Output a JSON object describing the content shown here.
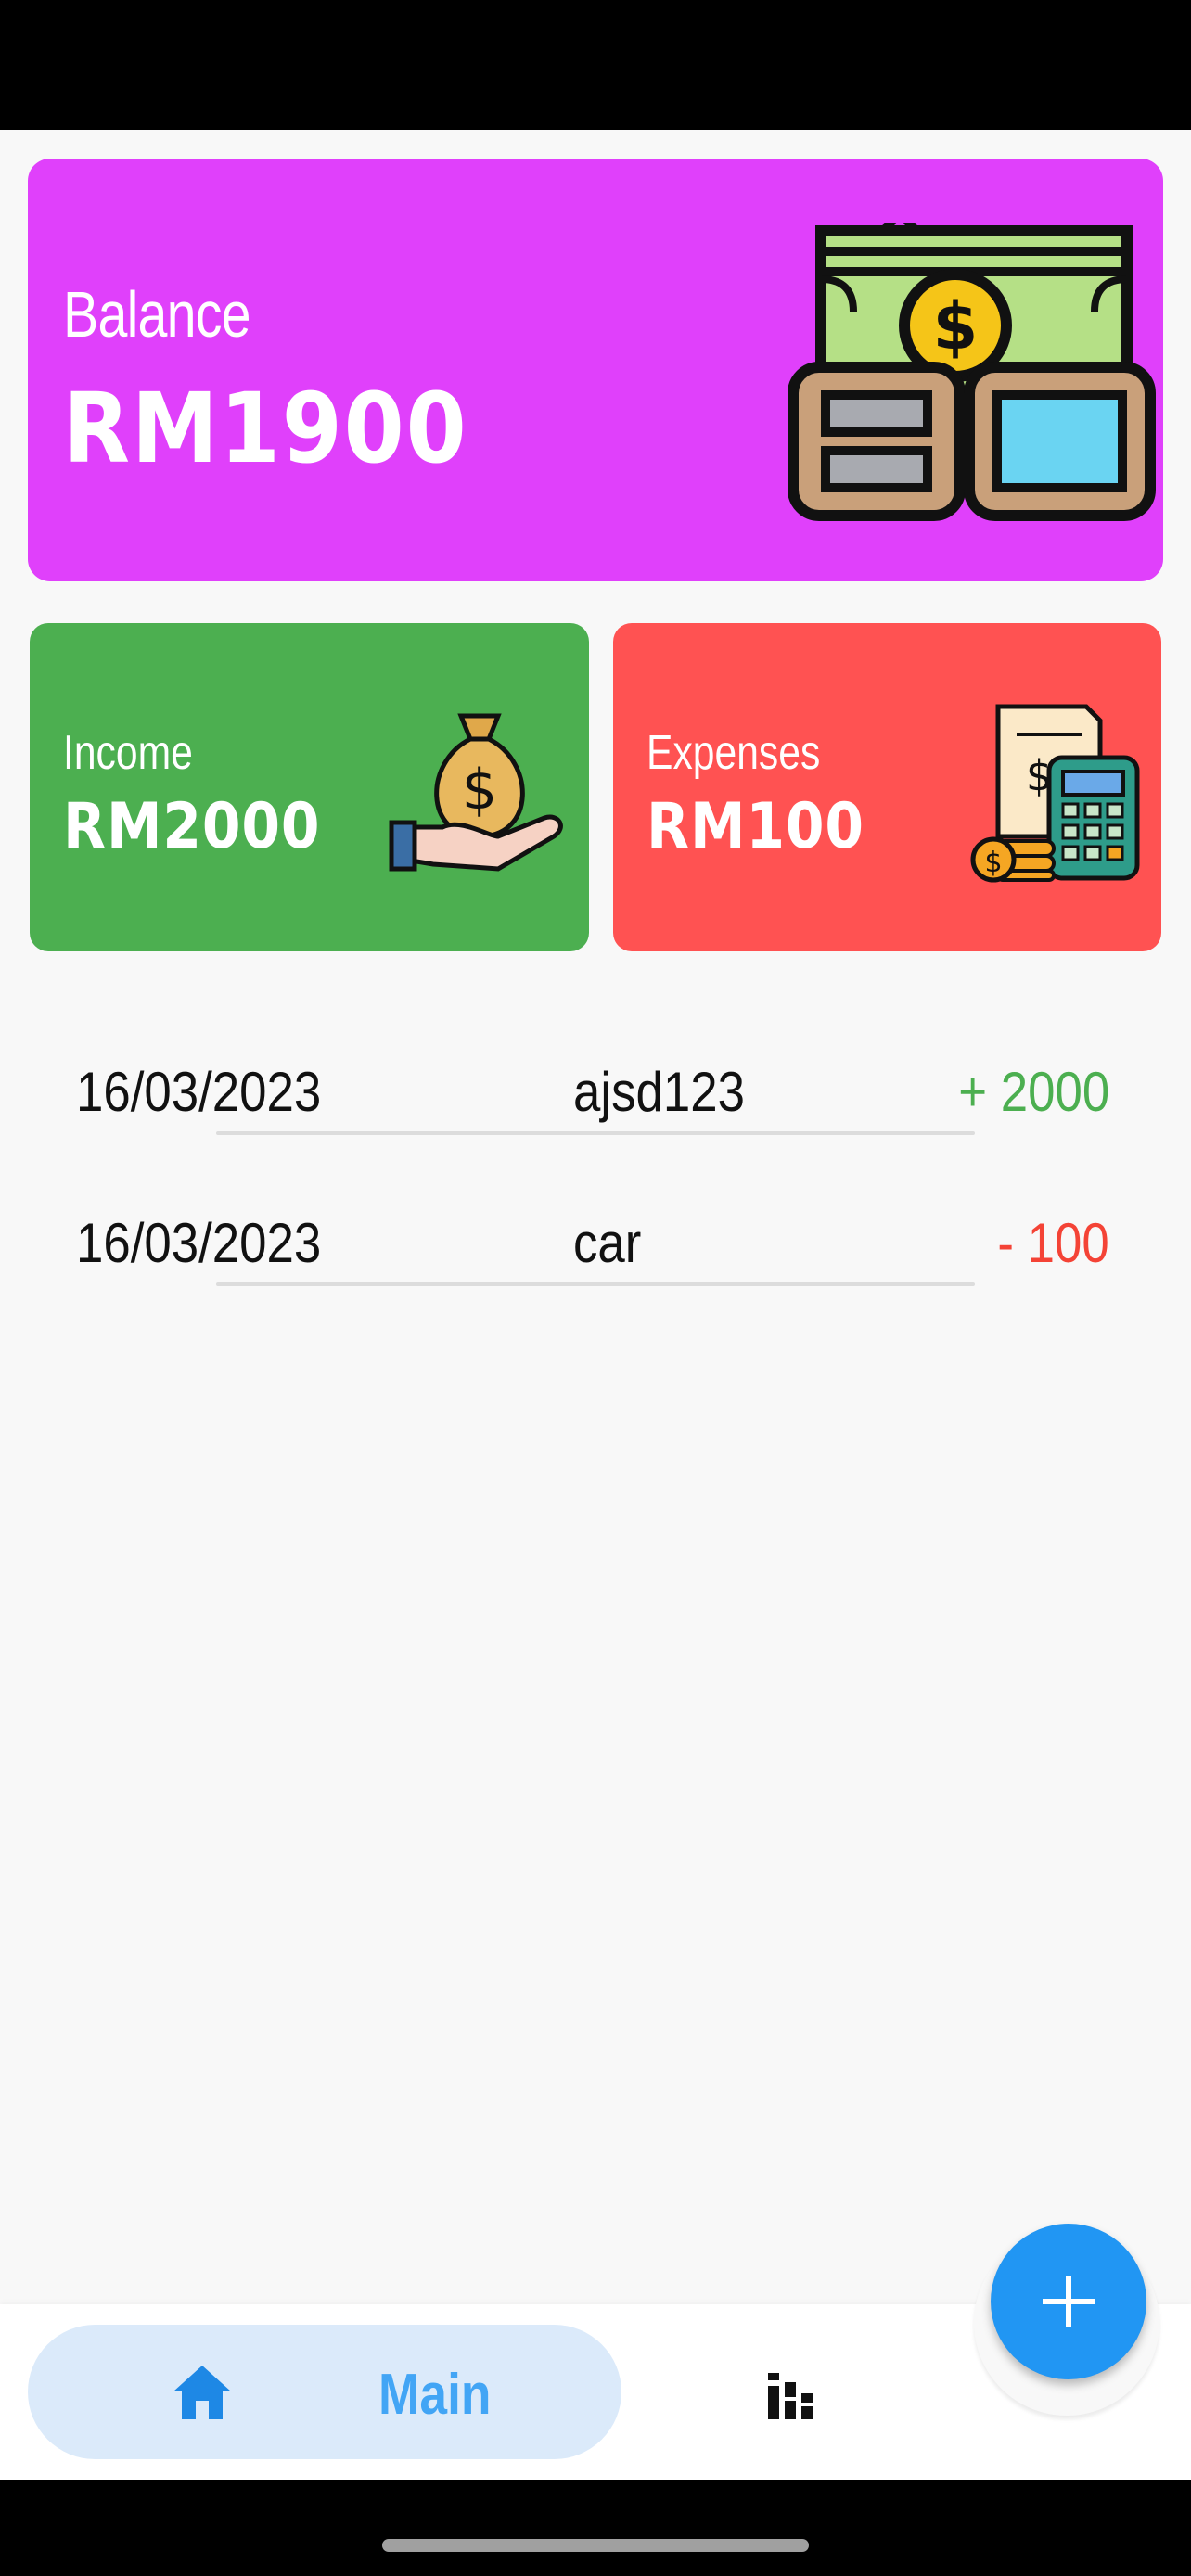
{
  "balance": {
    "label": "Balance",
    "value": "RM1900",
    "icon": "money-cash-icon"
  },
  "income": {
    "label": "Income",
    "value": "RM2000",
    "icon": "money-bag-hand-icon"
  },
  "expenses": {
    "label": "Expenses",
    "value": "RM100",
    "icon": "calculator-receipt-icon"
  },
  "transactions": [
    {
      "date": "16/03/2023",
      "name": "ajsd123",
      "amount": "+ 2000",
      "type": "income"
    },
    {
      "date": "16/03/2023",
      "name": "car",
      "amount": "- 100",
      "type": "expense"
    }
  ],
  "nav": {
    "main_label": "Main",
    "main_icon": "home-icon",
    "stats_icon": "bar-chart-icon",
    "fab_icon": "plus-icon"
  },
  "colors": {
    "balance_card": "#e040fb",
    "income_card": "#4caf50",
    "expense_card": "#ff5252",
    "accent": "#2196f3"
  }
}
